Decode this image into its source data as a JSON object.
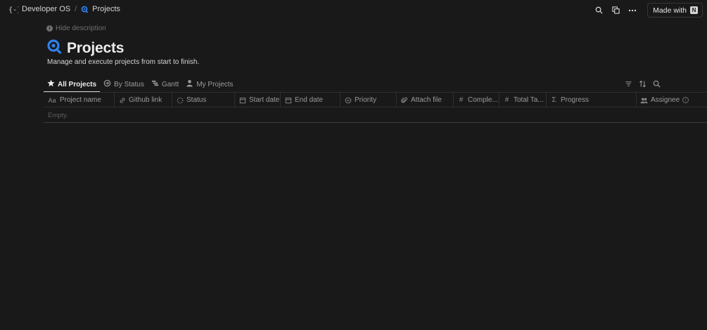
{
  "breadcrumb": {
    "workspace": "Developer OS",
    "separator": "/",
    "page": "Projects"
  },
  "topbar": {
    "made_with_label": "Made with",
    "icons": [
      "search-icon",
      "duplicate-icon",
      "more-icon"
    ]
  },
  "page": {
    "hide_description": "Hide description",
    "title": "Projects",
    "description": "Manage and execute projects from start to finish.",
    "accent_color": "#2f80ed"
  },
  "views": [
    {
      "label": "All Projects",
      "icon": "star-icon",
      "active": true
    },
    {
      "label": "By Status",
      "icon": "status-icon",
      "active": false
    },
    {
      "label": "Gantt",
      "icon": "gantt-icon",
      "active": false
    },
    {
      "label": "My Projects",
      "icon": "person-icon",
      "active": false
    }
  ],
  "columns": [
    {
      "label": "Project name",
      "icon": "Aa"
    },
    {
      "label": "Github link",
      "icon": "link-icon"
    },
    {
      "label": "Status",
      "icon": "status-icon"
    },
    {
      "label": "Start date",
      "icon": "calendar-icon"
    },
    {
      "label": "End date",
      "icon": "calendar-icon"
    },
    {
      "label": "Priority",
      "icon": "select-icon"
    },
    {
      "label": "Attach file",
      "icon": "paperclip-icon"
    },
    {
      "label": "Comple...",
      "icon": "#"
    },
    {
      "label": "Total Ta...",
      "icon": "#"
    },
    {
      "label": "Progress",
      "icon": "Σ"
    },
    {
      "label": "Assignee",
      "icon": "people-icon"
    }
  ],
  "table": {
    "empty_text": "Empty."
  }
}
